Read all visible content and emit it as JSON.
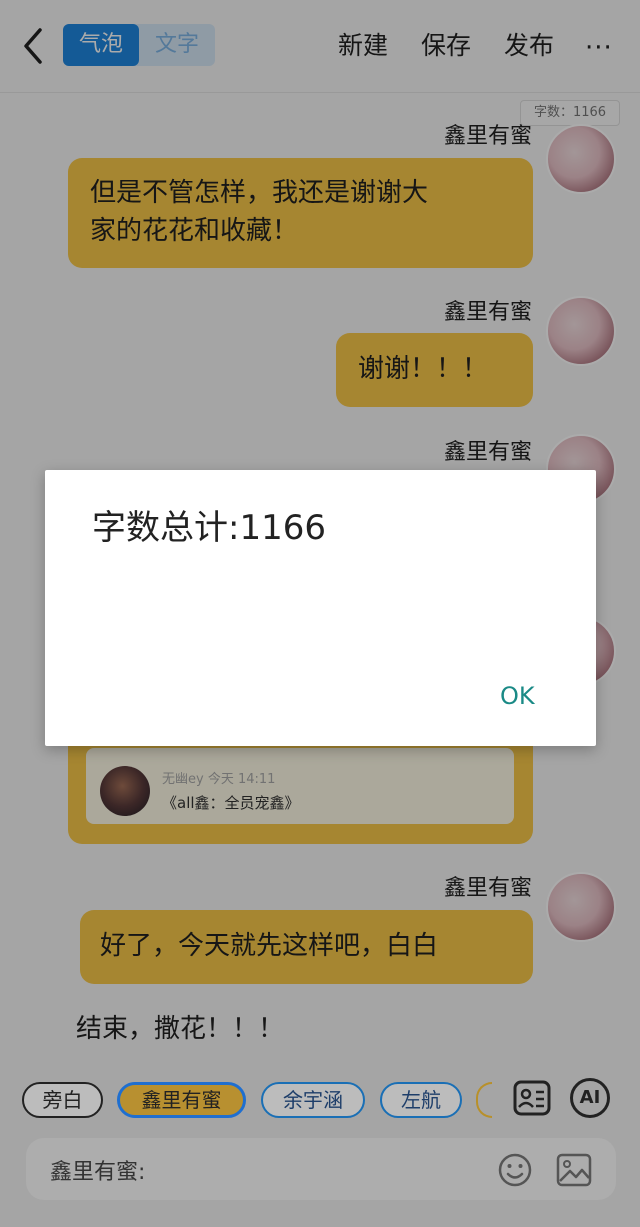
{
  "header": {
    "tab_active": "气泡",
    "tab_inactive": "文字",
    "new_label": "新建",
    "save_label": "保存",
    "publish_label": "发布",
    "more_label": "···",
    "word_count_tag": "字数：1166"
  },
  "messages": [
    {
      "sender": "鑫里有蜜",
      "text_line1": "但是不管怎样，我还是谢谢大",
      "text_line2": "家的花花和收藏！"
    },
    {
      "sender": "鑫里有蜜",
      "text": "谢谢！！！"
    },
    {
      "sender": "鑫里有蜜"
    },
    {
      "sender": "鑫里有蜜",
      "text": "好了，今天就先这样吧，白白"
    }
  ],
  "card": {
    "meta": "无幽ey   今天 14:11",
    "title": "《all鑫：全员宠鑫》"
  },
  "plain_text": "结束，撒花！！！",
  "toolbar": {
    "chips": [
      "旁白",
      "鑫里有蜜",
      "余宇涵",
      "左航"
    ],
    "ai_label": "AI"
  },
  "input": {
    "label": "鑫里有蜜:"
  },
  "dialog": {
    "message": "字数总计:1166",
    "ok_label": "OK"
  },
  "colors": {
    "accent": "#1f86e0",
    "bubble": "#f8c84a",
    "ok": "#1a8a86"
  },
  "icons": [
    "back-arrow-icon",
    "contact-card-icon",
    "ai-icon",
    "emoji-icon",
    "image-icon"
  ]
}
